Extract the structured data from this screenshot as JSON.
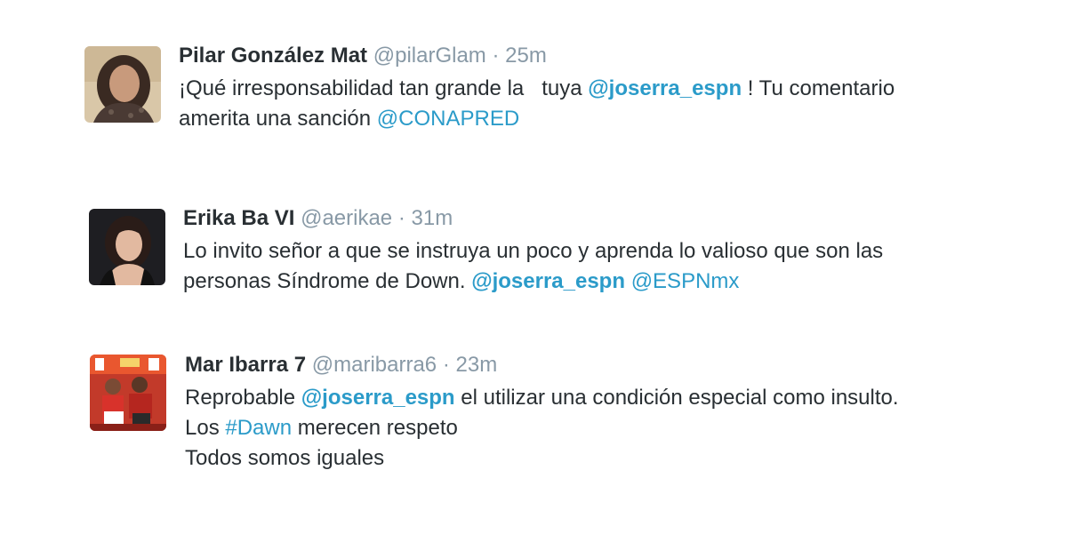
{
  "tweets": [
    {
      "name": "Pilar González Mat",
      "handle": "@pilarGlam",
      "sep": "·",
      "time": "25m",
      "avatar": "avatar-woman-dark-hair",
      "l1_a": "¡Qué irresponsabilidad tan grande la   tuya ",
      "l1_m": "@joserra_espn",
      "l1_b": " ! Tu comentario",
      "l2_a": "amerita una sanción ",
      "l2_m": "@CONAPRED"
    },
    {
      "name": "Erika Ba VI",
      "handle": "@aerikae",
      "sep": "·",
      "time": "31m",
      "avatar": "avatar-woman-portrait",
      "l1_a": "Lo invito señor a que se instruya un poco y aprenda lo valioso que son las",
      "l2_a": "personas Síndrome de Down. ",
      "l2_m1": "@joserra_espn",
      "l2_sp": " ",
      "l2_m2": "@ESPNmx"
    },
    {
      "name": "Mar Ibarra 7",
      "handle": "@maribarra6",
      "sep": "·",
      "time": "23m",
      "avatar": "avatar-soccer-players",
      "l1_a": "Reprobable ",
      "l1_m": "@joserra_espn",
      "l1_b": " el utilizar una condición especial como insulto.",
      "l2_a": "Los ",
      "l2_h": "#Dawn",
      "l2_b": " merecen respeto",
      "l3_a": "Todos somos iguales"
    }
  ],
  "colors": {
    "name": "#292f33",
    "meta": "#8899a6",
    "link": "#2b9bc9"
  }
}
